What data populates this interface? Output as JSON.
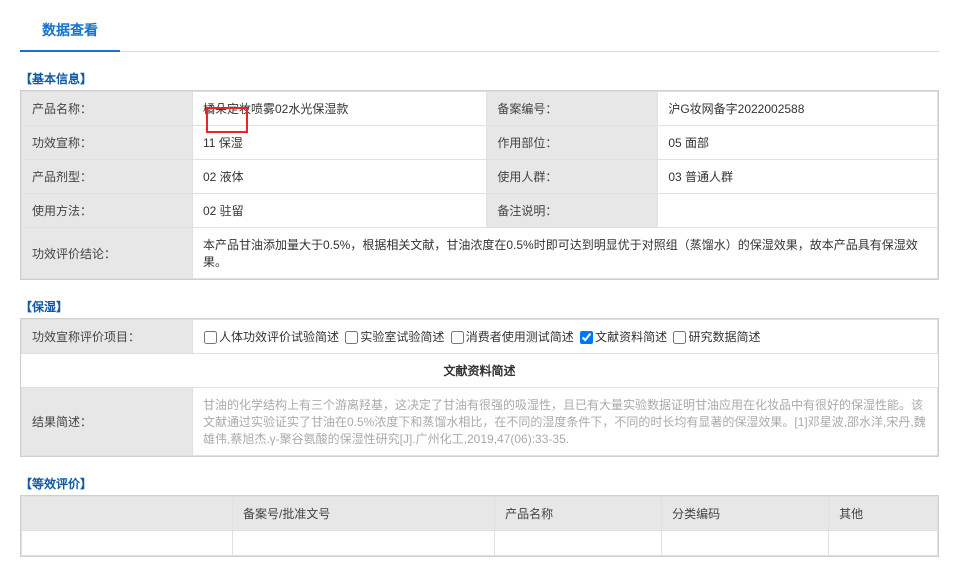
{
  "tab": {
    "title": "数据查看"
  },
  "basic": {
    "section_title": "【基本信息】",
    "rows": {
      "product_name_label": "产品名称：",
      "product_name_value": "橘朵定妆喷雾02水光保湿款",
      "record_no_label": "备案编号：",
      "record_no_value": "沪G妆网备字2022002588",
      "efficacy_label": "功效宣称：",
      "efficacy_value": "11 保湿",
      "part_label": "作用部位：",
      "part_value": "05 面部",
      "form_label": "产品剂型：",
      "form_value": "02 液体",
      "population_label": "使用人群：",
      "population_value": "03 普通人群",
      "method_label": "使用方法：",
      "method_value": "02 驻留",
      "note_label": "备注说明：",
      "note_value": "",
      "conclusion_label": "功效评价结论：",
      "conclusion_value": "本产品甘油添加量大于0.5%，根据相关文献，甘油浓度在0.5%时即可达到明显优于对照组（蒸馏水）的保湿效果，故本产品具有保湿效果。"
    }
  },
  "moist": {
    "section_title": "【保湿】",
    "item_label": "功效宣称评价项目：",
    "options": {
      "opt1": "人体功效评价试验简述",
      "opt2": "实验室试验简述",
      "opt3": "消费者使用测试简述",
      "opt4": "文献资料简述",
      "opt5": "研究数据简述"
    },
    "lit_title": "文献资料简述",
    "result_label": "结果简述：",
    "result_value": "甘油的化学结构上有三个游离羟基，这决定了甘油有很强的吸湿性，且已有大量实验数据证明甘油应用在化妆品中有很好的保湿性能。该文献通过实验证实了甘油在0.5%浓度下和蒸馏水相比，在不同的湿度条件下，不同的时长均有显著的保湿效果。[1]邓星波,邵水洋,宋丹,魏雄伟,蔡旭杰.γ-聚谷氨酸的保湿性研究[J].广州化工,2019,47(06):33-35."
  },
  "eq": {
    "section_title": "【等效评价】",
    "headers": {
      "blank": "",
      "col1": "备案号/批准文号",
      "col2": "产品名称",
      "col3": "分类编码",
      "col4": "其他"
    }
  }
}
